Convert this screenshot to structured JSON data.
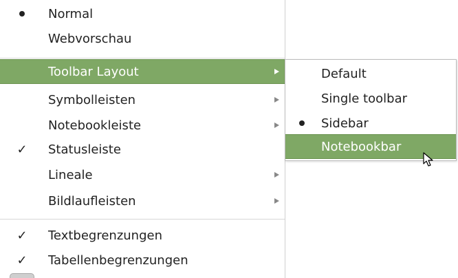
{
  "menu": {
    "items": [
      {
        "label": "Normal",
        "mark": "bullet"
      },
      {
        "label": "Webvorschau",
        "mark": ""
      },
      {
        "label": "Toolbar Layout",
        "mark": "",
        "submenu": true,
        "highlighted": true
      },
      {
        "label": "Symbolleisten",
        "mark": "",
        "submenu": true
      },
      {
        "label": "Notebookleiste",
        "mark": "",
        "submenu": true
      },
      {
        "label": "Statusleiste",
        "mark": "check"
      },
      {
        "label": "Lineale",
        "mark": "",
        "submenu": true
      },
      {
        "label": "Bildlaufleisten",
        "mark": "",
        "submenu": true
      },
      {
        "label": "Textbegrenzungen",
        "mark": "check"
      },
      {
        "label": "Tabellenbegrenzungen",
        "mark": "check"
      }
    ],
    "check_glyph": "✓"
  },
  "submenu": {
    "items": [
      {
        "label": "Default",
        "mark": ""
      },
      {
        "label": "Single toolbar",
        "mark": ""
      },
      {
        "label": "Sidebar",
        "mark": "bullet"
      },
      {
        "label": "Notebookbar",
        "mark": "",
        "highlighted": true
      }
    ]
  },
  "colors": {
    "highlight": "#7fa865",
    "highlight_text": "#ffffff",
    "text": "#222222"
  },
  "icons": {
    "submenu_arrow": "triangle-right-icon",
    "radio_selected": "bullet-icon",
    "checked": "checkmark-icon",
    "pointer": "mouse-pointer-icon"
  }
}
